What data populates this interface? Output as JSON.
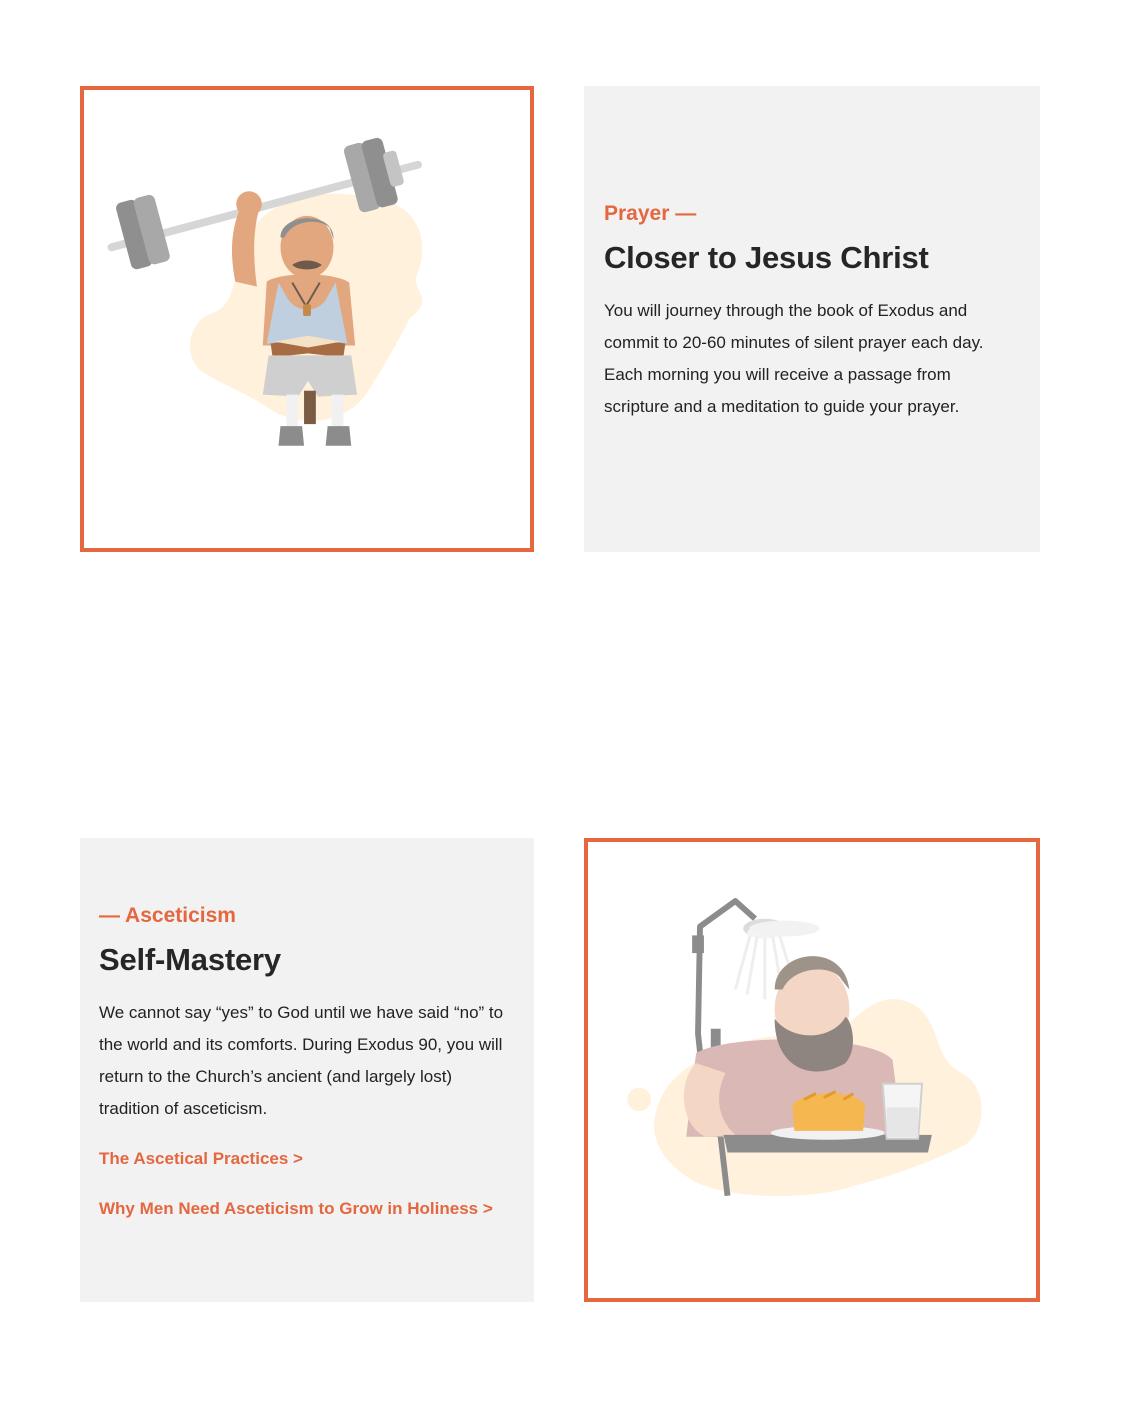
{
  "sections": [
    {
      "eyebrow": "Prayer —",
      "heading": "Closer to Jesus Christ",
      "body": "You will journey through the book of Exodus and commit to 20-60 minutes of silent prayer each day. Each morning you will receive a passage from scripture and a meditation to guide your prayer.",
      "illustration": "man-lifting-barbell-reading-bible"
    },
    {
      "eyebrow": "— Asceticism",
      "heading": "Self-Mastery",
      "body": "We cannot say “yes” to God until we have said “no” to the world and its comforts. During Exodus 90, you will return to the Church’s ancient (and largely lost) tradition of asceticism.",
      "links": [
        "The Ascetical Practices >",
        "Why Men Need Asceticism to Grow in Holiness >"
      ],
      "illustration": "bearded-man-cold-shower-with-bread"
    }
  ],
  "colors": {
    "accent": "#e4673f",
    "panel": "#f2f2f2",
    "blob": "#fff1dc"
  }
}
